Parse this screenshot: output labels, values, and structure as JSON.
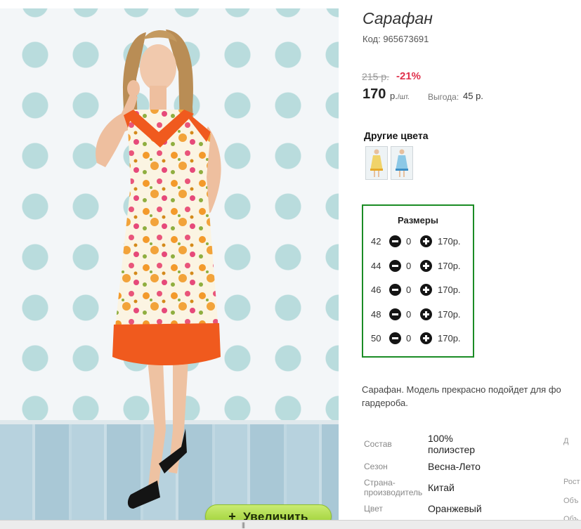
{
  "product": {
    "title": "Сарафан",
    "code": "Код: 965673691",
    "old_price": "215 р.",
    "discount": "-21%",
    "price": "170",
    "price_unit": "р.",
    "price_unit_suffix": "/шт.",
    "savings_label": "Выгода:",
    "savings_value": "45 р."
  },
  "gallery": {
    "zoom_button_icon": "+",
    "zoom_button_label": "Увеличить"
  },
  "other_colors": {
    "title": "Другие цвета",
    "swatches": [
      "yellow-floral-dress",
      "blue-floral-dress"
    ]
  },
  "sizes": {
    "title": "Размеры",
    "rows": [
      {
        "size": "42",
        "qty": "0",
        "price": "170р."
      },
      {
        "size": "44",
        "qty": "0",
        "price": "170р."
      },
      {
        "size": "46",
        "qty": "0",
        "price": "170р."
      },
      {
        "size": "48",
        "qty": "0",
        "price": "170р."
      },
      {
        "size": "50",
        "qty": "0",
        "price": "170р."
      }
    ]
  },
  "description": {
    "line1": "Сарафан. Модель прекрасно подойдет для фо",
    "line2": "гардероба."
  },
  "properties": [
    {
      "label": "Состав",
      "value_line1": "100%",
      "value_line2": "полиэстер"
    },
    {
      "label": "Сезон",
      "value_line1": "Весна-Лето"
    },
    {
      "label_line1": "Страна-",
      "label_line2": "производитель",
      "value_line1": "Китай"
    },
    {
      "label": "Цвет",
      "value_line1": "Оранжевый"
    }
  ],
  "right_column_cut": {
    "t1": "Д",
    "t2": "Рост",
    "t3": "Объ",
    "t4": "Объ"
  },
  "scrollbar": {
    "grip": "|||"
  },
  "colors": {
    "discount": "#e0314c",
    "sizes_border": "#1b8c25",
    "zoom_button": "#a6d63a",
    "dress_orange": "#f05a1e"
  }
}
